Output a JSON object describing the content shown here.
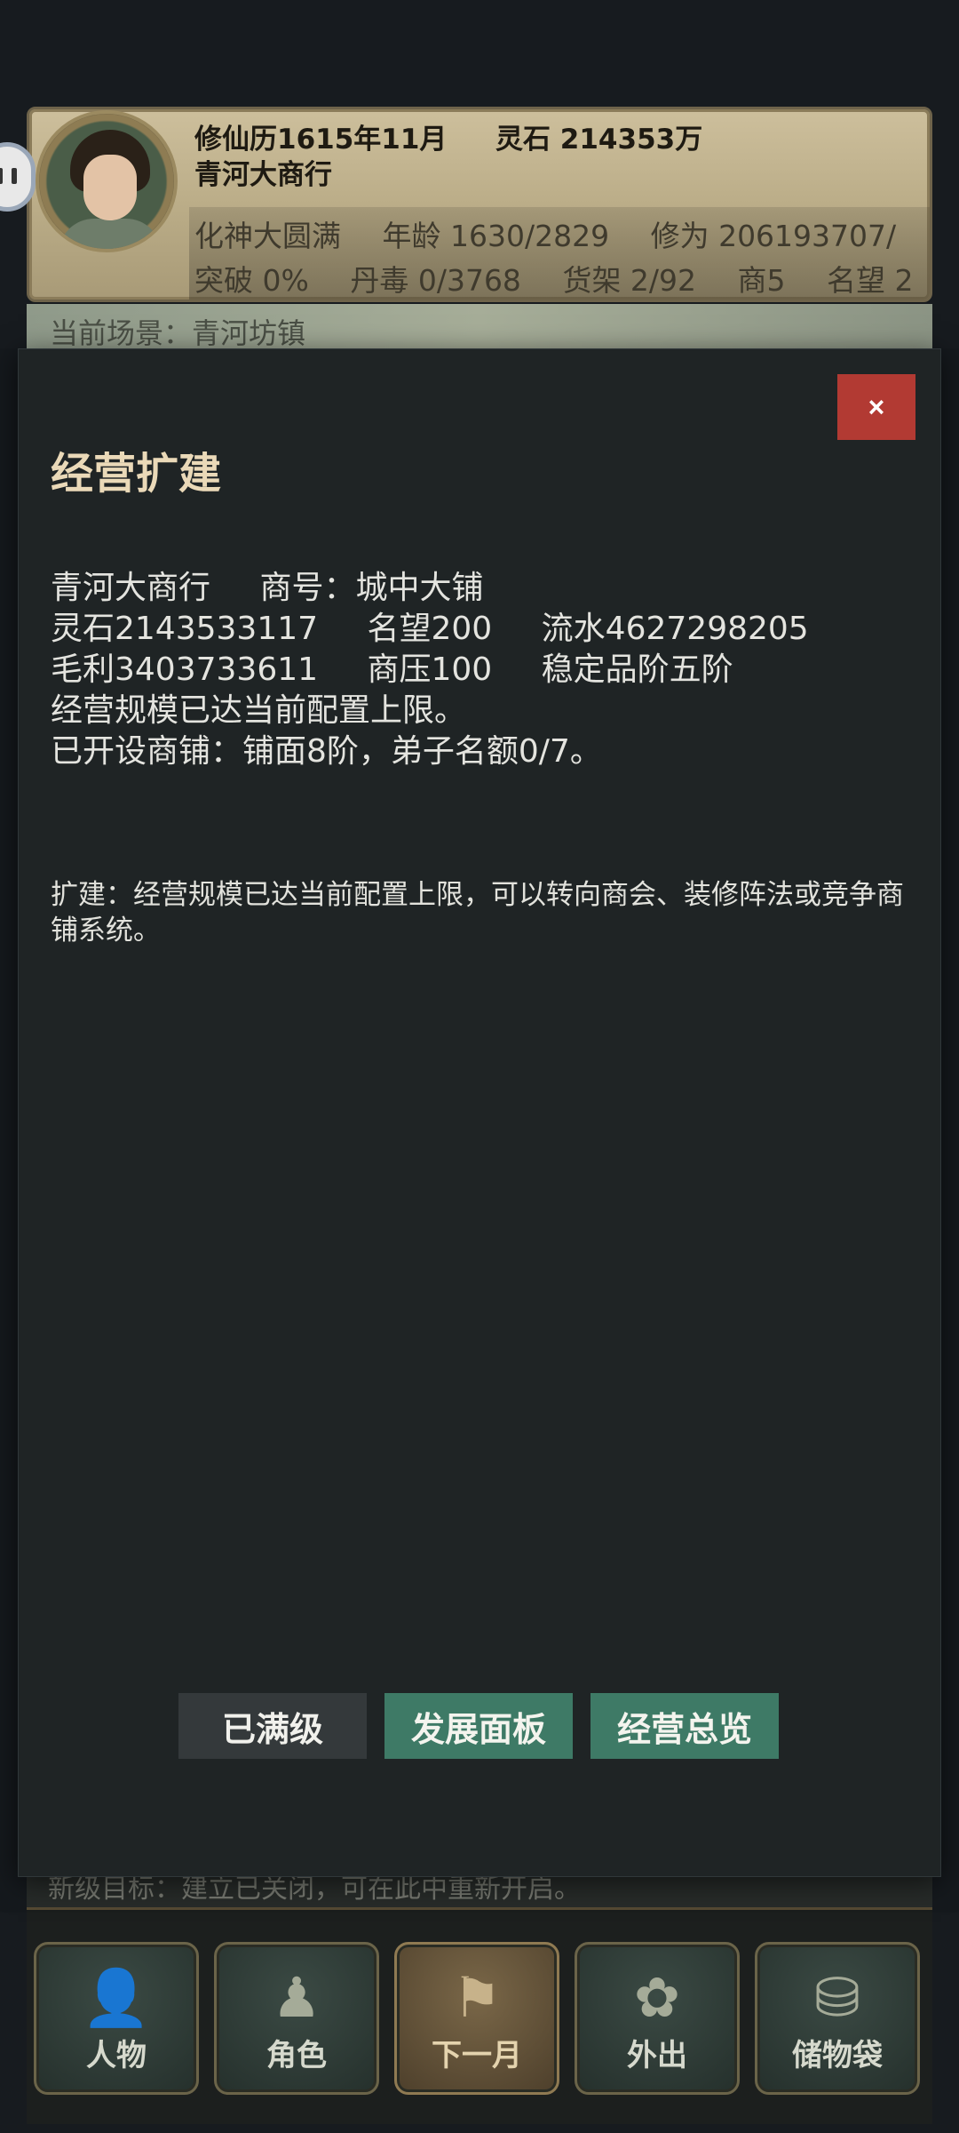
{
  "header": {
    "calendar": "修仙历1615年11月",
    "spirit_stones": "灵石 214353万",
    "shop_name": "青河大商行",
    "realm": "化神大圆满",
    "age": "年龄 1630/2829",
    "cultivation": "修为 206193707/",
    "breakthrough": "突破 0%",
    "pill_toxicity": "丹毒 0/3768",
    "shelves": "货架 2/92",
    "merchant_level": "商5",
    "reputation_label": "名望 2",
    "scene_text": "当前场景：青河坊镇"
  },
  "modal": {
    "title": "经营扩建",
    "close_label": "×",
    "info": {
      "shop_name": "青河大商行",
      "shop_title": "商号：城中大铺",
      "spirit_stones": "灵石2143533117",
      "reputation": "名望200",
      "turnover": "流水4627298205",
      "gross_profit": "毛利3403733611",
      "pressure": "商压100",
      "grade": "稳定品阶五阶",
      "limit_text": "经营规模已达当前配置上限。",
      "opened_shops": "已开设商铺：铺面8阶，弟子名额0/7。"
    },
    "note": "扩建：经营规模已达当前配置上限，可以转向商会、装修阵法或竞争商铺系统。",
    "buttons": {
      "maxed": "已满级",
      "development_panel": "发展面板",
      "business_overview": "经营总览"
    }
  },
  "bottom": {
    "strip_text": "新级目标：建立已关闭，可在此中重新开启。",
    "nav": [
      {
        "label": "人物",
        "icon": "person-icon"
      },
      {
        "label": "角色",
        "icon": "robed-figure-icon"
      },
      {
        "label": "下一月",
        "icon": "flag-icon"
      },
      {
        "label": "外出",
        "icon": "lotus-figure-icon"
      },
      {
        "label": "储物袋",
        "icon": "storage-bag-icon"
      }
    ]
  }
}
